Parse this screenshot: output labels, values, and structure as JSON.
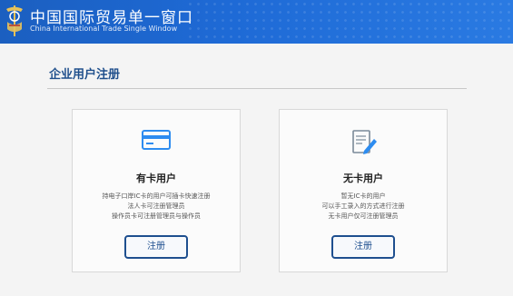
{
  "header": {
    "title_cn": "中国国际贸易单一窗口",
    "title_en": "China International Trade Single Window"
  },
  "section": {
    "title": "企业用户注册"
  },
  "cards": [
    {
      "icon": "card-icon",
      "title": "有卡用户",
      "desc": [
        "持电子口岸IC卡的用户可插卡快速注册",
        "法人卡可注册管理员",
        "操作员卡可注册管理员与操作员"
      ],
      "button": "注册"
    },
    {
      "icon": "edit-document-icon",
      "title": "无卡用户",
      "desc": [
        "暂无IC卡的用户",
        "可以手工录入的方式进行注册",
        "无卡用户仅可注册管理员"
      ],
      "button": "注册"
    }
  ],
  "colors": {
    "header_blue": "#1e6ad6",
    "accent_navy": "#1e4f8f",
    "icon_blue": "#2d8cf0"
  }
}
